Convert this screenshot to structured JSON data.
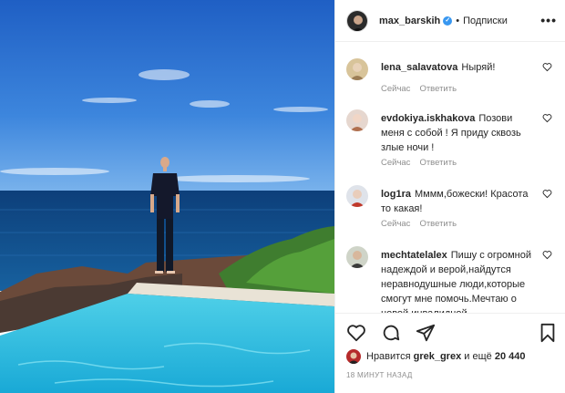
{
  "post": {
    "username": "max_barskih",
    "separator": "•",
    "follow_label": "Подписки",
    "more_label": "•••",
    "photo_alt": "photo"
  },
  "comments": [
    {
      "user": "lena_salavatova",
      "text": "Ныряй!",
      "time": "Сейчас",
      "reply": "Ответить"
    },
    {
      "user": "evdokiya.iskhakova",
      "text": "Позови меня с собой ! Я приду сквозь злые ночи !",
      "time": "Сейчас",
      "reply": "Ответить"
    },
    {
      "user": "log1ra",
      "text": "Мммм,божески! Красота то какая!",
      "time": "Сейчас",
      "reply": "Ответить"
    },
    {
      "user": "mechtatelalex",
      "text": "Пишу с огромной надеждой и верой,найдутся неравнодушные люди,которые смогут мне помочь.Мечтаю о новой инвалидной"
    }
  ],
  "likes": {
    "prefix": "Нравится",
    "user": "grek_grex",
    "middle": "и ещё",
    "count": "20 440"
  },
  "timestamp": "18 МИНУТ НАЗАД",
  "colors": {
    "verified": "#3897f0",
    "muted": "#8e8e8e",
    "text": "#262626"
  }
}
